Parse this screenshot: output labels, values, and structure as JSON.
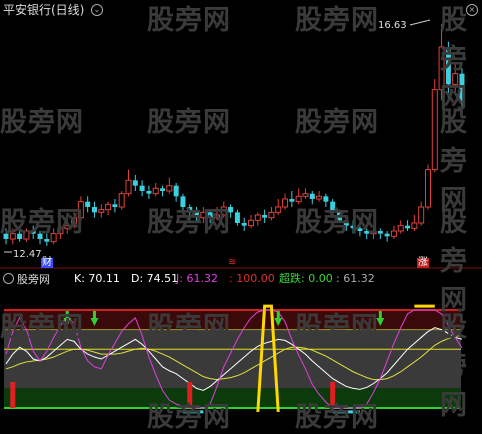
{
  "colors": {
    "up": "#e0413c",
    "down": "#39d0e0",
    "k_line": "#ffffff",
    "d_line": "#e0e040",
    "j_line": "#e040e0",
    "green_band": "#0b3a0b",
    "red_band": "#3a0a0a",
    "gray_band": "#3a3a3a",
    "yellow_seg": "#ffd800",
    "cyan_seg": "#3ad8e8",
    "label_green": "#38d838",
    "label_red": "#e03030",
    "watermark": "#3a3a3a"
  },
  "header": {
    "title": "平安银行(日线)",
    "chevron_icon": "chevron-down-icon"
  },
  "annotations": {
    "high_price": "16.63",
    "low_price": "12.47",
    "badge_cai": "财",
    "badge_zhang": "涨",
    "marker_mid": "≋"
  },
  "watermarks": [
    "股旁网",
    "股旁网",
    "股旁网",
    "股旁网",
    "股旁网",
    "股旁网",
    "股旁网",
    "股旁网",
    "股旁网",
    "股旁网",
    "股旁网",
    "股旁网",
    "股旁网",
    "股旁网",
    "股旁网",
    "股旁网",
    "股旁网"
  ],
  "indicator": {
    "name": "股旁网",
    "k_label": "K: 70.11",
    "d_label": "D: 74.51",
    "j_label": "J: 61.32",
    "level_label": ": 100.00",
    "chaodie_label": "超跌: 0.00",
    "last_label": ": 61.32"
  },
  "chart_data": {
    "type": "candlestick",
    "candles": [
      [
        12.7,
        12.6,
        12.8,
        12.5
      ],
      [
        12.6,
        12.7,
        12.8,
        12.5
      ],
      [
        12.7,
        12.6,
        12.75,
        12.55
      ],
      [
        12.6,
        12.75,
        12.8,
        12.55
      ],
      [
        12.75,
        12.7,
        12.85,
        12.6
      ],
      [
        12.7,
        12.6,
        12.75,
        12.5
      ],
      [
        12.6,
        12.55,
        12.7,
        12.47
      ],
      [
        12.55,
        12.7,
        12.8,
        12.5
      ],
      [
        12.7,
        12.8,
        12.9,
        12.6
      ],
      [
        12.8,
        12.85,
        12.95,
        12.7
      ],
      [
        12.85,
        13.0,
        13.1,
        12.8
      ],
      [
        13.0,
        13.3,
        13.4,
        12.95
      ],
      [
        13.3,
        13.2,
        13.4,
        13.1
      ],
      [
        13.2,
        13.1,
        13.3,
        13.0
      ],
      [
        13.1,
        13.15,
        13.25,
        13.0
      ],
      [
        13.15,
        13.25,
        13.3,
        13.05
      ],
      [
        13.25,
        13.2,
        13.35,
        13.1
      ],
      [
        13.2,
        13.45,
        13.5,
        13.15
      ],
      [
        13.45,
        13.7,
        13.9,
        13.4
      ],
      [
        13.7,
        13.6,
        13.8,
        13.5
      ],
      [
        13.6,
        13.5,
        13.7,
        13.4
      ],
      [
        13.5,
        13.45,
        13.6,
        13.35
      ],
      [
        13.45,
        13.55,
        13.65,
        13.4
      ],
      [
        13.55,
        13.5,
        13.6,
        13.4
      ],
      [
        13.5,
        13.6,
        13.75,
        13.45
      ],
      [
        13.6,
        13.4,
        13.65,
        13.3
      ],
      [
        13.4,
        13.2,
        13.45,
        13.1
      ],
      [
        13.2,
        13.1,
        13.25,
        12.95
      ],
      [
        13.1,
        13.0,
        13.2,
        12.9
      ],
      [
        13.0,
        13.1,
        13.2,
        12.9
      ],
      [
        13.1,
        13.0,
        13.15,
        12.9
      ],
      [
        13.0,
        13.05,
        13.2,
        12.95
      ],
      [
        13.05,
        13.2,
        13.3,
        13.0
      ],
      [
        13.2,
        13.1,
        13.25,
        13.0
      ],
      [
        13.1,
        12.9,
        13.15,
        12.85
      ],
      [
        12.9,
        12.85,
        13.0,
        12.75
      ],
      [
        12.85,
        12.95,
        13.05,
        12.8
      ],
      [
        12.95,
        13.05,
        13.1,
        12.85
      ],
      [
        13.05,
        13.0,
        13.15,
        12.9
      ],
      [
        13.0,
        13.1,
        13.2,
        12.95
      ],
      [
        13.1,
        13.2,
        13.35,
        13.05
      ],
      [
        13.2,
        13.35,
        13.45,
        13.15
      ],
      [
        13.35,
        13.3,
        13.5,
        13.2
      ],
      [
        13.3,
        13.4,
        13.55,
        13.25
      ],
      [
        13.4,
        13.45,
        13.55,
        13.35
      ],
      [
        13.45,
        13.35,
        13.5,
        13.25
      ],
      [
        13.35,
        13.4,
        13.5,
        13.3
      ],
      [
        13.4,
        13.3,
        13.45,
        13.2
      ],
      [
        13.3,
        13.1,
        13.35,
        13.0
      ],
      [
        13.1,
        12.95,
        13.15,
        12.9
      ],
      [
        12.95,
        12.85,
        13.0,
        12.75
      ],
      [
        12.85,
        12.8,
        12.95,
        12.7
      ],
      [
        12.8,
        12.75,
        12.9,
        12.65
      ],
      [
        12.75,
        12.7,
        12.8,
        12.6
      ],
      [
        12.7,
        12.75,
        12.85,
        12.6
      ],
      [
        12.75,
        12.7,
        12.8,
        12.6
      ],
      [
        12.7,
        12.65,
        12.75,
        12.55
      ],
      [
        12.65,
        12.75,
        12.85,
        12.6
      ],
      [
        12.75,
        12.85,
        12.95,
        12.7
      ],
      [
        12.85,
        12.8,
        12.95,
        12.75
      ],
      [
        12.8,
        12.9,
        13.05,
        12.75
      ],
      [
        12.9,
        13.2,
        13.3,
        12.85
      ],
      [
        13.2,
        13.9,
        14.0,
        13.15
      ],
      [
        13.9,
        15.4,
        15.6,
        13.85
      ],
      [
        15.4,
        16.2,
        16.63,
        15.2
      ],
      [
        16.2,
        15.5,
        16.3,
        15.2
      ],
      [
        15.5,
        15.7,
        15.9,
        15.3
      ],
      [
        15.7,
        15.2,
        15.8,
        15.0
      ]
    ],
    "kdj": {
      "k": [
        45,
        55,
        62,
        58,
        50,
        48,
        52,
        58,
        64,
        70,
        68,
        60,
        55,
        52,
        50,
        54,
        58,
        62,
        66,
        70,
        65,
        58,
        50,
        42,
        38,
        35,
        30,
        25,
        20,
        18,
        22,
        28,
        34,
        40,
        46,
        52,
        58,
        63,
        66,
        68,
        70,
        69,
        65,
        60,
        55,
        48,
        42,
        36,
        30,
        26,
        22,
        20,
        19,
        21,
        25,
        30,
        36,
        44,
        52,
        60,
        66,
        72,
        78,
        82,
        80,
        76,
        72,
        70.11
      ],
      "d": [
        40,
        42,
        45,
        47,
        48,
        49,
        50,
        52,
        55,
        58,
        60,
        60,
        59,
        57,
        55,
        55,
        55,
        56,
        58,
        60,
        61,
        60,
        58,
        55,
        52,
        48,
        44,
        40,
        36,
        32,
        30,
        29,
        30,
        31,
        33,
        36,
        40,
        44,
        48,
        52,
        56,
        60,
        62,
        62,
        61,
        59,
        56,
        53,
        49,
        45,
        41,
        37,
        34,
        31,
        29,
        29,
        30,
        33,
        37,
        42,
        47,
        52,
        58,
        64,
        68,
        71,
        73,
        74.51
      ],
      "j": [
        55,
        78,
        92,
        80,
        58,
        48,
        58,
        72,
        84,
        94,
        86,
        62,
        48,
        42,
        40,
        54,
        66,
        78,
        86,
        92,
        74,
        52,
        34,
        18,
        8,
        4,
        2,
        0,
        0,
        0,
        4,
        22,
        42,
        56,
        70,
        82,
        92,
        98,
        100,
        100,
        98,
        88,
        70,
        54,
        40,
        24,
        14,
        6,
        0,
        0,
        0,
        0,
        0,
        4,
        16,
        30,
        48,
        66,
        82,
        96,
        100,
        100,
        100,
        100,
        96,
        84,
        72,
        61.32
      ]
    },
    "levels": {
      "upper": 100,
      "lower": 0,
      "mid_upper": 80,
      "mid_lower": 20
    },
    "signals_down": [
      9,
      13,
      40,
      55
    ],
    "signals_up": [
      1,
      27,
      48
    ]
  }
}
